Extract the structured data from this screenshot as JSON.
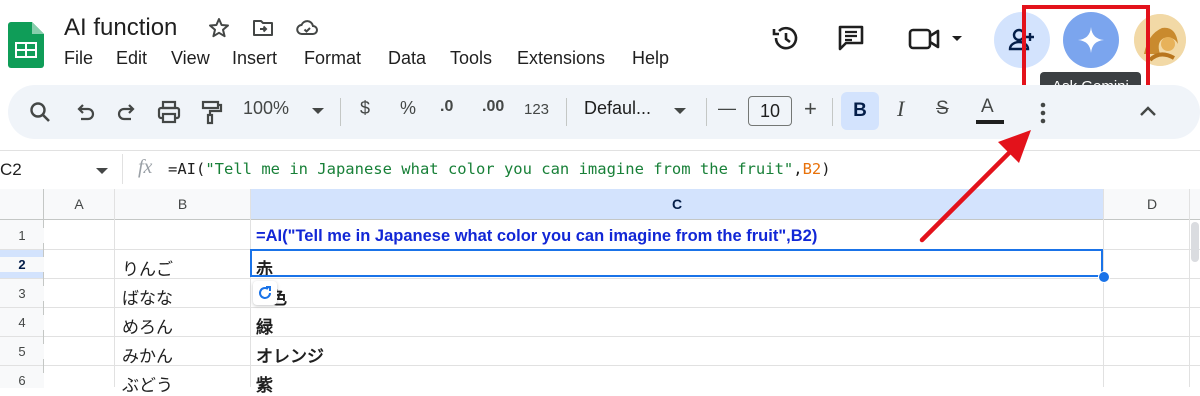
{
  "header": {
    "doc_title": "AI function",
    "menu": [
      "File",
      "Edit",
      "View",
      "Insert",
      "Format",
      "Data",
      "Tools",
      "Extensions",
      "Help"
    ],
    "tooltip": "Ask Gemini"
  },
  "toolbar": {
    "zoom": "100%",
    "currency": "$",
    "percent": "%",
    "decrease_decimal": ".0",
    "increase_decimal": ".00",
    "number_format": "123",
    "font": "Defaul...",
    "font_size": "10",
    "minus": "—",
    "plus": "+",
    "bold": "B",
    "italic": "I",
    "strike": "S",
    "text_color": "A"
  },
  "formula_bar": {
    "cell_ref": "C2",
    "fx": "fx",
    "formula_prefix": "=AI(",
    "formula_string": "\"Tell me in Japanese what color you can imagine from the fruit\"",
    "formula_comma": ",",
    "formula_ref": "B2",
    "formula_suffix": ")"
  },
  "grid": {
    "columns": [
      "A",
      "B",
      "C",
      "D"
    ],
    "rows": [
      {
        "num": "1",
        "b": "",
        "c": "=AI(\"Tell me in Japanese what color you can imagine from the fruit\",B2)"
      },
      {
        "num": "2",
        "b": "りんご",
        "c": "赤"
      },
      {
        "num": "3",
        "b": "ばなな",
        "c": "色"
      },
      {
        "num": "4",
        "b": "めろん",
        "c": "緑"
      },
      {
        "num": "5",
        "b": "みかん",
        "c": "オレンジ"
      },
      {
        "num": "6",
        "b": "ぶどう",
        "c": "紫"
      }
    ]
  },
  "colors": {
    "highlight": "#e3121b",
    "accent_blue": "#1a73e8",
    "formula_blue": "#1227d6",
    "selected_header": "#d3e3fd"
  },
  "icons": [
    "sheets-logo",
    "star-icon",
    "move-folder-icon",
    "cloud-icon",
    "history-icon",
    "comment-icon",
    "video-icon",
    "share-icon",
    "gemini-icon",
    "search-icon",
    "undo-icon",
    "redo-icon",
    "print-icon",
    "paint-format-icon",
    "refresh-icon",
    "more-icon",
    "chevron-up-icon"
  ]
}
